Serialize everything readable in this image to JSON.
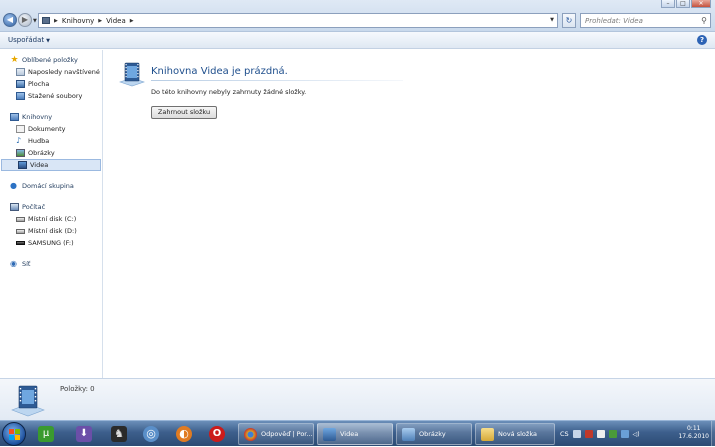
{
  "window": {
    "controls": {
      "minimize": "–",
      "maximize": "□",
      "close": "✕"
    }
  },
  "address": {
    "back": "◀",
    "forward": "▶",
    "dropdown": "▼",
    "separator": "▶",
    "crumbs": [
      "Knihovny",
      "Videa"
    ],
    "refresh": "↻",
    "search_placeholder": "Prohledat: Videa",
    "search_icon": "⚲"
  },
  "toolbar": {
    "organize_label": "Uspořádat",
    "organize_arrow": "▼",
    "help": "?"
  },
  "nav": {
    "favorites": {
      "label": "Oblíbené položky",
      "items": [
        {
          "label": "Naposledy navštívené",
          "icon": "recent-places-icon"
        },
        {
          "label": "Plocha",
          "icon": "desktop-icon"
        },
        {
          "label": "Stažené soubory",
          "icon": "downloads-icon"
        }
      ]
    },
    "libraries": {
      "label": "Knihovny",
      "items": [
        {
          "label": "Dokumenty",
          "icon": "documents-icon"
        },
        {
          "label": "Hudba",
          "icon": "music-icon",
          "glyph": "♪"
        },
        {
          "label": "Obrázky",
          "icon": "pictures-icon"
        },
        {
          "label": "Videa",
          "icon": "videos-icon",
          "selected": true
        }
      ]
    },
    "homegroup": {
      "label": "Domácí skupina",
      "glyph": "●"
    },
    "computer": {
      "label": "Počítač",
      "items": [
        {
          "label": "Místní disk (C:)",
          "icon": "drive-icon"
        },
        {
          "label": "Místní disk (D:)",
          "icon": "drive-icon"
        },
        {
          "label": "SAMSUNG (F:)",
          "icon": "usb-drive-icon"
        }
      ]
    },
    "network": {
      "label": "Síť",
      "glyph": "◉"
    },
    "star_glyph": "★"
  },
  "content": {
    "heading": "Knihovna Videa je prázdná.",
    "description": "Do této knihovny nebyly zahrnuty žádné složky.",
    "include_button": "Zahrnout složku"
  },
  "details": {
    "item_count": "Položky: 0"
  },
  "taskbar": {
    "pinned": [
      {
        "name": "utorrent-icon",
        "glyph": "µ",
        "color": "#3a9a2e"
      },
      {
        "name": "antivirus-icon",
        "glyph": "⬇",
        "color": "#6b4fa8"
      },
      {
        "name": "game-icon",
        "glyph": "♞",
        "color": "#2a2a2a"
      },
      {
        "name": "itunes-icon",
        "glyph": "◎",
        "color": "#5a8fc9"
      },
      {
        "name": "firefox-icon",
        "glyph": "◐",
        "color": "#e07b22"
      },
      {
        "name": "opera-icon",
        "glyph": "O",
        "color": "#cc1b1b"
      }
    ],
    "tasks": [
      {
        "label": "Odpověď | Por...",
        "name": "task-chrome",
        "color": "#d9a324",
        "active": false
      },
      {
        "label": "Videa",
        "name": "task-videa",
        "color": "#3f78c0",
        "active": true
      },
      {
        "label": "Obrázky",
        "name": "task-obrazky",
        "color": "#6f9fd4",
        "active": false
      },
      {
        "label": "Nová složka",
        "name": "task-nova-slozka",
        "color": "#e8c45c",
        "active": false
      }
    ],
    "tray": {
      "language": "CS",
      "time": "0:11",
      "date": "17.6.2010",
      "volume": "◁)"
    }
  }
}
